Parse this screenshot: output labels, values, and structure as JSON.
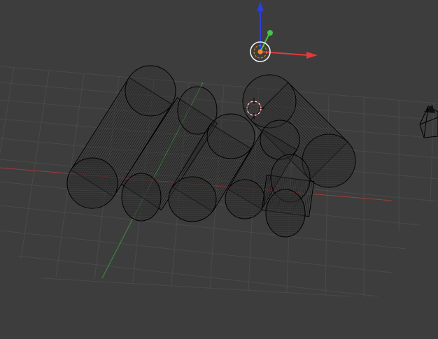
{
  "viewport": {
    "background": "#3d3d3d",
    "grid_color": "#4a4a4a",
    "x_axis_color": "#a13b3b",
    "y_axis_color": "#3f8f3f"
  },
  "gizmo": {
    "x_arrow_color": "#e03a3a",
    "y_arrow_color": "#43c443",
    "z_arrow_color": "#2c3fd6",
    "origin_color": "#f08a1c",
    "icon": "transform-manipulator-icon"
  },
  "cursor_3d": {
    "icon": "3d-cursor-icon",
    "color": "#e03a3a"
  },
  "camera": {
    "icon": "camera-icon"
  },
  "objects": [
    {
      "name": "cylinder"
    },
    {
      "name": "cylinder"
    },
    {
      "name": "cylinder"
    },
    {
      "name": "cylinder"
    },
    {
      "name": "cylinder"
    },
    {
      "name": "cylinder"
    }
  ]
}
